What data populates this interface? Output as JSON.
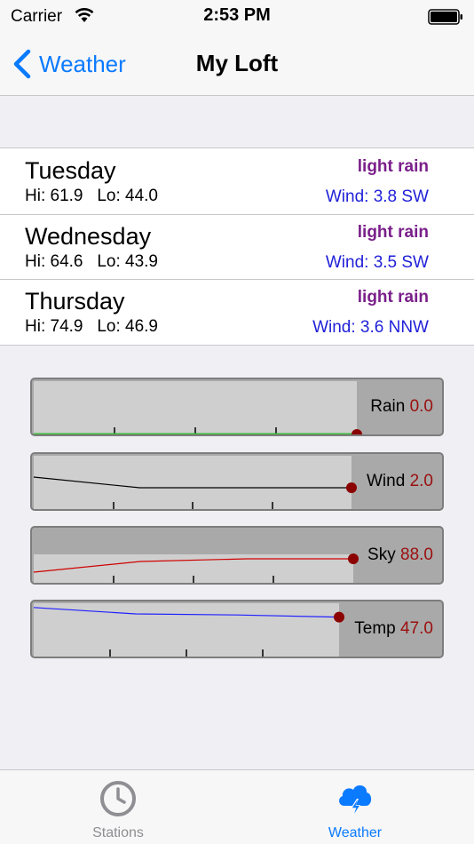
{
  "status_bar": {
    "carrier": "Carrier",
    "time": "2:53 PM"
  },
  "nav": {
    "back_label": "Weather",
    "title": "My Loft"
  },
  "forecast": [
    {
      "day": "Tuesday",
      "hi": "Hi: 61.9",
      "lo": "Lo: 44.0",
      "condition": "light rain",
      "wind": "Wind: 3.8 SW"
    },
    {
      "day": "Wednesday",
      "hi": "Hi: 64.6",
      "lo": "Lo: 43.9",
      "condition": "light rain",
      "wind": "Wind: 3.5 SW"
    },
    {
      "day": "Thursday",
      "hi": "Hi: 74.9",
      "lo": "Lo: 46.9",
      "condition": "light rain",
      "wind": "Wind: 3.6 NNW"
    }
  ],
  "gauges": [
    {
      "name": "Rain",
      "value": "0.0",
      "line_color": "#3cba3c",
      "trend": [
        0.0,
        0.0,
        0.0,
        0.0
      ]
    },
    {
      "name": "Wind",
      "value": "2.0",
      "line_color": "#000000",
      "trend": [
        0.6,
        0.4,
        0.4,
        0.4
      ]
    },
    {
      "name": "Sky",
      "value": "88.0",
      "line_color": "#d00000",
      "trend": [
        0.2,
        0.4,
        0.45,
        0.45
      ]
    },
    {
      "name": "Temp",
      "value": "47.0",
      "line_color": "#2020ff",
      "trend": [
        0.92,
        0.8,
        0.78,
        0.74
      ]
    }
  ],
  "tabs": [
    {
      "label": "Stations",
      "icon": "clock-icon",
      "selected": false
    },
    {
      "label": "Weather",
      "icon": "cloud-lightning-icon",
      "selected": true
    }
  ],
  "colors": {
    "accent": "#0a7aff",
    "condition": "#7a1f8a",
    "wind": "#1f1fd8",
    "gauge_value": "#9b0f0f"
  }
}
